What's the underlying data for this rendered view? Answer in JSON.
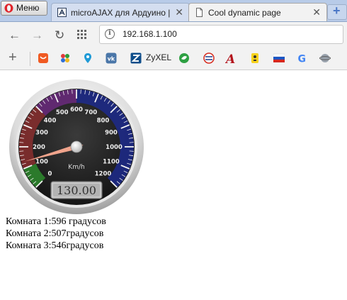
{
  "browser": {
    "menu_label": "Меню",
    "tabs": [
      {
        "title": "microAJAX для Ардуино |",
        "active": false
      },
      {
        "title": "Cool dynamic page",
        "active": true
      }
    ],
    "new_tab_label": "+",
    "address": "192.168.1.100",
    "bookmarks": {
      "add_label": "+",
      "zyxel_label": "ZyXEL",
      "icons": [
        "aliexpress-icon",
        "puzzle-icon",
        "map-pin-icon",
        "vk-icon",
        "zyxel-icon",
        "leaf-icon",
        "rzd-icon",
        "font-a-icon",
        "game-icon",
        "flag-ru-icon",
        "google-icon",
        "planet-icon"
      ]
    }
  },
  "gauge": {
    "unit_label": "Km/h",
    "value": 130.0,
    "value_display": "130.00",
    "min": 0,
    "max": 1200,
    "ticks": [
      "0",
      "100",
      "200",
      "300",
      "400",
      "500",
      "600",
      "700",
      "800",
      "900",
      "1000",
      "1100",
      "1200"
    ],
    "zones": [
      {
        "from": 0,
        "to": 100,
        "color": "#2e8b2e"
      },
      {
        "from": 100,
        "to": 400,
        "color": "#8a2f2f"
      },
      {
        "from": 400,
        "to": 600,
        "color": "#6b2a7e"
      },
      {
        "from": 600,
        "to": 1200,
        "color": "#1d2a8c"
      }
    ],
    "needle_color": "#f0a48c"
  },
  "rooms": [
    {
      "text": "Комната 1:596 градусов"
    },
    {
      "text": "Комната 2:507градусов"
    },
    {
      "text": "Комната 3:546градусов"
    }
  ]
}
